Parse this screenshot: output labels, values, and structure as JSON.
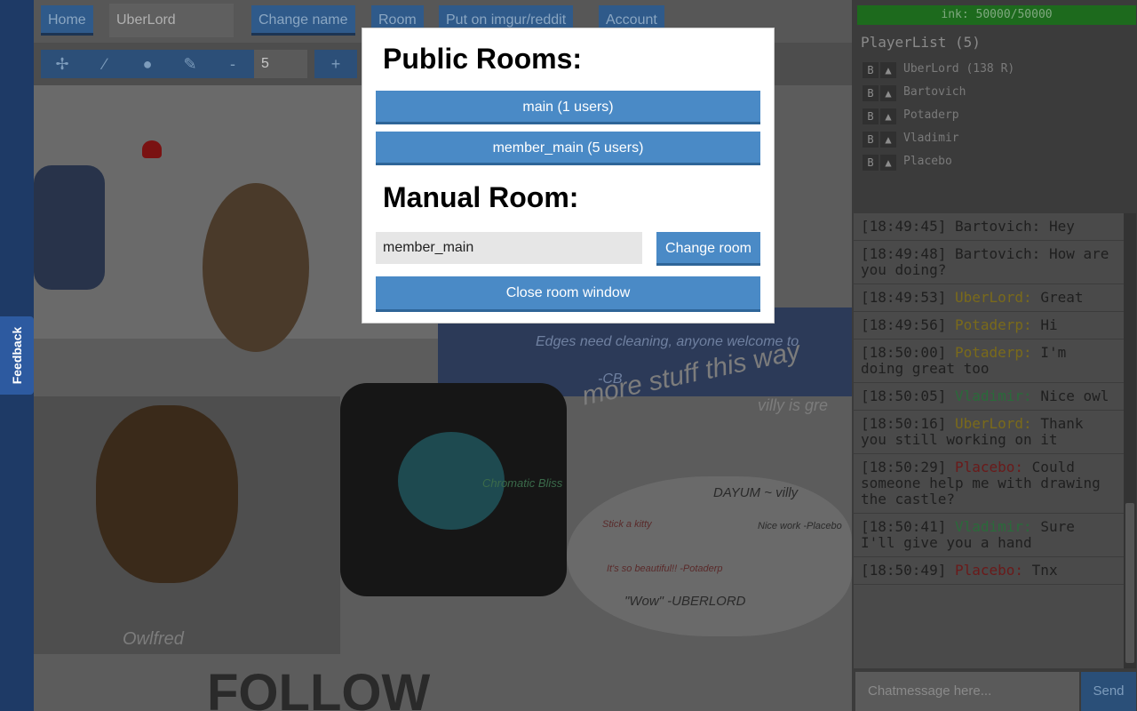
{
  "feedback": {
    "label": "Feedback"
  },
  "topbar": {
    "home": "Home",
    "username": "UberLord",
    "change_name": "Change name",
    "room": "Room",
    "imgur": "Put on imgur/reddit",
    "account": "Account"
  },
  "tools": {
    "move_icon": "move-icon",
    "line_icon": "line-icon",
    "brush_icon": "brush-icon",
    "picker_icon": "picker-icon",
    "minus": "-",
    "size": "5",
    "plus": "+"
  },
  "ink": {
    "label": "ink: 50000/50000"
  },
  "players": {
    "title": "PlayerList (5)",
    "b": "B",
    "up": "▲",
    "items": [
      {
        "name": "UberLord (138 R)",
        "color": "#7a7a7a"
      },
      {
        "name": "Bartovich",
        "color": "#7a7a7a"
      },
      {
        "name": "Potaderp",
        "color": "#7a7a7a"
      },
      {
        "name": "Vladimir",
        "color": "#7a7a7a"
      },
      {
        "name": "Placebo",
        "color": "#7a7a7a"
      }
    ]
  },
  "chat": {
    "messages": [
      {
        "time": "[18:49:45]",
        "user": "Bartovich:",
        "text": "Hey",
        "color": "#1f1f1f"
      },
      {
        "time": "[18:49:48]",
        "user": "Bartovich:",
        "text": "How are you doing?",
        "color": "#1f1f1f"
      },
      {
        "time": "[18:49:53]",
        "user": "UberLord:",
        "text": "Great",
        "color": "#7a6a1a"
      },
      {
        "time": "[18:49:56]",
        "user": "Potaderp:",
        "text": "Hi",
        "color": "#7a6a1a"
      },
      {
        "time": "[18:50:00]",
        "user": "Potaderp:",
        "text": "I'm doing great too",
        "color": "#7a6a1a"
      },
      {
        "time": "[18:50:05]",
        "user": "Vladimir:",
        "text": "Nice owl",
        "color": "#2a6a3a"
      },
      {
        "time": "[18:50:16]",
        "user": "UberLord:",
        "text": "Thank you still working on it",
        "color": "#7a6a1a"
      },
      {
        "time": "[18:50:29]",
        "user": "Placebo:",
        "text": "Could someone help me with drawing the castle?",
        "color": "#6a1a1a"
      },
      {
        "time": "[18:50:41]",
        "user": "Vladimir:",
        "text": "Sure I'll give you a hand",
        "color": "#2a6a3a"
      },
      {
        "time": "[18:50:49]",
        "user": "Placebo:",
        "text": "Tnx",
        "color": "#6a1a1a"
      }
    ],
    "placeholder": "Chatmessage here...",
    "send": "Send"
  },
  "modal": {
    "public_title": "Public Rooms:",
    "rooms": [
      "main (1 users)",
      "member_main (5 users)"
    ],
    "manual_title": "Manual Room:",
    "manual_value": "member_main",
    "change_room": "Change room",
    "close": "Close room window"
  },
  "canvas_text": {
    "edges": "Edges need cleaning, anyone welcome to",
    "cb": "-CB",
    "more": "more stuff this way",
    "villy": "villy is gre",
    "owlfred": "Owlfred",
    "follow": "FOLLOW",
    "chromatic": "Chromatic Bliss",
    "dayum": "DAYUM ~ villy",
    "wow": "\"Wow\" -UBERLORD",
    "nice": "Nice work -Placebo",
    "stick": "Stick a kitty",
    "beautiful": "It's so beautiful!! -Potaderp"
  },
  "colors": {
    "accent": "#4a8ac6",
    "ink_green": "#1d6a1d",
    "dim_blue": "#2f5a8a"
  }
}
